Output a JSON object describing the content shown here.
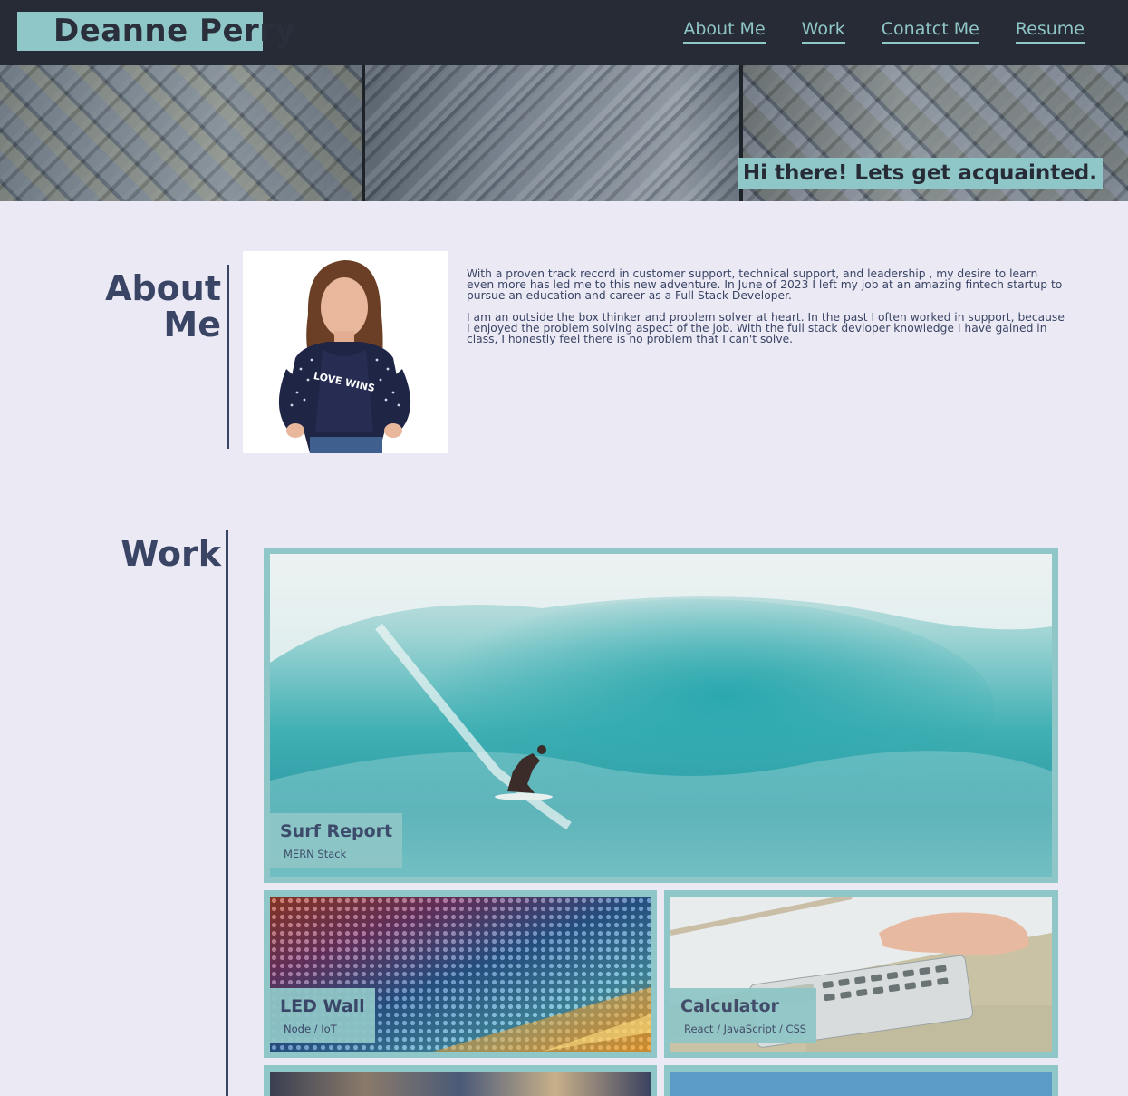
{
  "header": {
    "brand": "Deanne Perry",
    "nav": [
      {
        "label": "About Me"
      },
      {
        "label": "Work"
      },
      {
        "label": "Conatct Me"
      },
      {
        "label": "Resume"
      }
    ]
  },
  "hero": {
    "tagline": "Hi there! Lets get acquainted."
  },
  "about": {
    "title_line1": "About",
    "title_line2": "Me",
    "paragraphs": [
      "With a proven track record in customer support, technical support, and leadership , my desire to learn even more has led me to this new adventure. In June of 2023 I left my job at an amazing fintech startup to pursue an education and career as a Full Stack Developer.",
      "I am an outside the box thinker and problem solver at heart. In the past I often worked in support, because I enjoyed the problem solving aspect of the job. With the full stack devloper knowledge I have gained in class, I honestly feel there is no problem that I can't solve."
    ],
    "shirt_text": "LOVE WINS"
  },
  "work": {
    "title": "Work",
    "projects": [
      {
        "title": "Surf Report",
        "stack": "MERN Stack"
      },
      {
        "title": "LED Wall",
        "stack": "Node / IoT"
      },
      {
        "title": "Calculator",
        "stack": "React / JavaScript / CSS"
      }
    ]
  },
  "colors": {
    "accent": "#8fc6c7",
    "header_bg": "#272b35",
    "page_bg": "#ebe9f3",
    "text": "#3a4566"
  }
}
